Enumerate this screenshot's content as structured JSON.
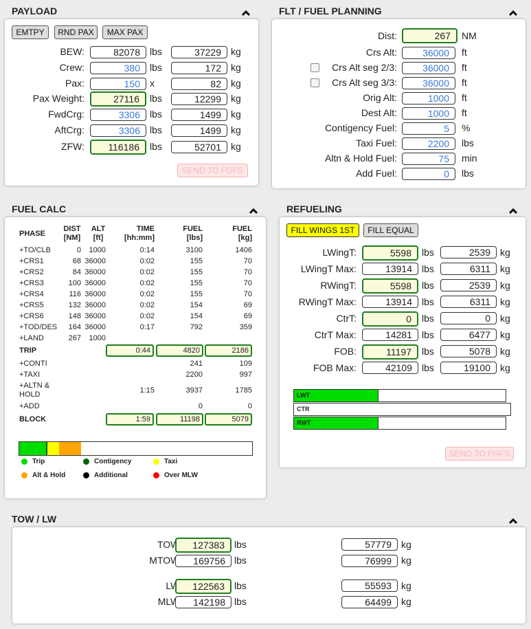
{
  "payload": {
    "title": "PAYLOAD",
    "buttons": [
      "EMTPY",
      "RND PAX",
      "MAX PAX"
    ],
    "rows": [
      {
        "label": "BEW:",
        "v1": "82078",
        "u1": "lbs",
        "v2": "37229",
        "u2": "kg"
      },
      {
        "label": "Crew:",
        "v1": "380",
        "u1": "lbs",
        "v2": "172",
        "u2": "kg"
      },
      {
        "label": "Pax:",
        "v1": "150",
        "u1": "x",
        "v2": "82",
        "u2": "kg"
      },
      {
        "label": "Pax Weight:",
        "v1": "27116",
        "u1": "lbs",
        "v2": "12299",
        "u2": "kg"
      },
      {
        "label": "FwdCrg:",
        "v1": "3306",
        "u1": "lbs",
        "v2": "1499",
        "u2": "kg"
      },
      {
        "label": "AftCrg:",
        "v1": "3306",
        "u1": "lbs",
        "v2": "1499",
        "u2": "kg"
      },
      {
        "label": "ZFW:",
        "v1": "116186",
        "u1": "lbs",
        "v2": "52701",
        "u2": "kg"
      }
    ],
    "send_label": "SEND TO FGFS"
  },
  "flt": {
    "title": "FLT / FUEL PLANNING",
    "rows": [
      {
        "label": "Dist:",
        "value": "267",
        "unit": "NM"
      },
      {
        "label": "Crs Alt:",
        "value": "36000",
        "unit": "ft"
      },
      {
        "label": "Crs Alt seg 2/3:",
        "value": "36000",
        "unit": "ft"
      },
      {
        "label": "Crs Alt seg 3/3:",
        "value": "36000",
        "unit": "ft"
      },
      {
        "label": "Orig Alt:",
        "value": "1000",
        "unit": "ft"
      },
      {
        "label": "Dest Alt:",
        "value": "1000",
        "unit": "ft"
      },
      {
        "label": "Contigency Fuel:",
        "value": "5",
        "unit": "%"
      },
      {
        "label": "Taxi Fuel:",
        "value": "2200",
        "unit": "lbs"
      },
      {
        "label": "Altn & Hold Fuel:",
        "value": "75",
        "unit": "min"
      },
      {
        "label": "Add Fuel:",
        "value": "0",
        "unit": "lbs"
      }
    ]
  },
  "fuelcalc": {
    "title": "FUEL CALC",
    "headers": {
      "phase": "PHASE",
      "dist1": "DIST",
      "dist2": "[NM]",
      "alt1": "ALT",
      "alt2": "[ft]",
      "time1": "TIME",
      "time2": "[hh:mm]",
      "fuel1": "FUEL",
      "fuel2": "[lbs]",
      "fuelkg1": "FUEL",
      "fuelkg2": "[kg]"
    },
    "phases": [
      {
        "phase": "+TO/CLB",
        "dist": "0",
        "alt": "1000",
        "time": "0:14",
        "lbs": "3100",
        "kg": "1406"
      },
      {
        "phase": "+CRS1",
        "dist": "68",
        "alt": "36000",
        "time": "0:02",
        "lbs": "155",
        "kg": "70"
      },
      {
        "phase": "+CRS2",
        "dist": "84",
        "alt": "36000",
        "time": "0:02",
        "lbs": "155",
        "kg": "70"
      },
      {
        "phase": "+CRS3",
        "dist": "100",
        "alt": "36000",
        "time": "0:02",
        "lbs": "155",
        "kg": "70"
      },
      {
        "phase": "+CRS4",
        "dist": "116",
        "alt": "36000",
        "time": "0:02",
        "lbs": "155",
        "kg": "70"
      },
      {
        "phase": "+CRS5",
        "dist": "132",
        "alt": "36000",
        "time": "0:02",
        "lbs": "154",
        "kg": "69"
      },
      {
        "phase": "+CRS6",
        "dist": "148",
        "alt": "36000",
        "time": "0:02",
        "lbs": "154",
        "kg": "69"
      },
      {
        "phase": "+TOD/DES",
        "dist": "164",
        "alt": "36000",
        "time": "0:17",
        "lbs": "792",
        "kg": "359"
      },
      {
        "phase": "+LAND",
        "dist": "267",
        "alt": "1000",
        "time": "",
        "lbs": "",
        "kg": ""
      }
    ],
    "trip": {
      "label": "TRIP",
      "time": "0:44",
      "lbs": "4820",
      "kg": "2186"
    },
    "extras": [
      {
        "label": "+CONTI",
        "time": "",
        "lbs": "241",
        "kg": "109"
      },
      {
        "label": "+TAXI",
        "time": "",
        "lbs": "2200",
        "kg": "997"
      },
      {
        "label": "+ALTN &",
        "label2": "HOLD",
        "time": "1:15",
        "lbs": "3937",
        "kg": "1785"
      },
      {
        "label": "+ADD",
        "time": "",
        "lbs": "0",
        "kg": "0"
      }
    ],
    "block": {
      "label": "BLOCK",
      "time": "1:59",
      "lbs": "11198",
      "kg": "5079"
    },
    "bar_segments": [
      {
        "name": "trip",
        "fraction": 0.115,
        "color": "#00dd00"
      },
      {
        "name": "contigency",
        "fraction": 0.006,
        "color": "#006600"
      },
      {
        "name": "taxi",
        "fraction": 0.049,
        "color": "#ffff00"
      },
      {
        "name": "altn-hold",
        "fraction": 0.095,
        "color": "#ffa500"
      }
    ],
    "legend": [
      {
        "label": "Trip",
        "color": "#00dd00"
      },
      {
        "label": "Contigency",
        "color": "#006600"
      },
      {
        "label": "Taxi",
        "color": "#ffff00"
      },
      {
        "label": "Alt & Hold",
        "color": "#ffa500"
      },
      {
        "label": "Additional",
        "color": "#000000"
      },
      {
        "label": "Over MLW",
        "color": "#ff0000"
      }
    ]
  },
  "refuel": {
    "title": "REFUELING",
    "btn_fill_wings": "FILL WINGS 1ST",
    "btn_fill_equal": "FILL EQUAL",
    "rows": [
      {
        "label": "LWingT:",
        "v1": "5598",
        "u1": "lbs",
        "v2": "2539",
        "u2": "kg"
      },
      {
        "label": "LWingT Max:",
        "v1": "13914",
        "u1": "lbs",
        "v2": "6311",
        "u2": "kg"
      },
      {
        "label": "RWingT:",
        "v1": "5598",
        "u1": "lbs",
        "v2": "2539",
        "u2": "kg"
      },
      {
        "label": "RWingT Max:",
        "v1": "13914",
        "u1": "lbs",
        "v2": "6311",
        "u2": "kg"
      },
      {
        "label": "CtrT:",
        "v1": "0",
        "u1": "lbs",
        "v2": "0",
        "u2": "kg"
      },
      {
        "label": "CtrT Max:",
        "v1": "14281",
        "u1": "lbs",
        "v2": "6477",
        "u2": "kg"
      },
      {
        "label": "FOB:",
        "v1": "11197",
        "u1": "lbs",
        "v2": "5078",
        "u2": "kg"
      },
      {
        "label": "FOB Max:",
        "v1": "42109",
        "u1": "lbs",
        "v2": "19100",
        "u2": "kg"
      }
    ],
    "tanks": [
      {
        "label": "LWT",
        "fill": 0.4
      },
      {
        "label": "CTR",
        "fill": 0.0
      },
      {
        "label": "RWT",
        "fill": 0.4
      }
    ],
    "send_label": "SEND TO FGFS"
  },
  "tow": {
    "title": "TOW / LW",
    "rows": [
      {
        "label": "TOW:",
        "v1": "127383",
        "u1": "lbs",
        "v2": "57779",
        "u2": "kg"
      },
      {
        "label": "MTOW:",
        "v1": "169756",
        "u1": "lbs",
        "v2": "76999",
        "u2": "kg"
      },
      {
        "label": "LW:",
        "v1": "122563",
        "u1": "lbs",
        "v2": "55593",
        "u2": "kg"
      },
      {
        "label": "MLW:",
        "v1": "142198",
        "u1": "lbs",
        "v2": "64499",
        "u2": "kg"
      }
    ]
  }
}
